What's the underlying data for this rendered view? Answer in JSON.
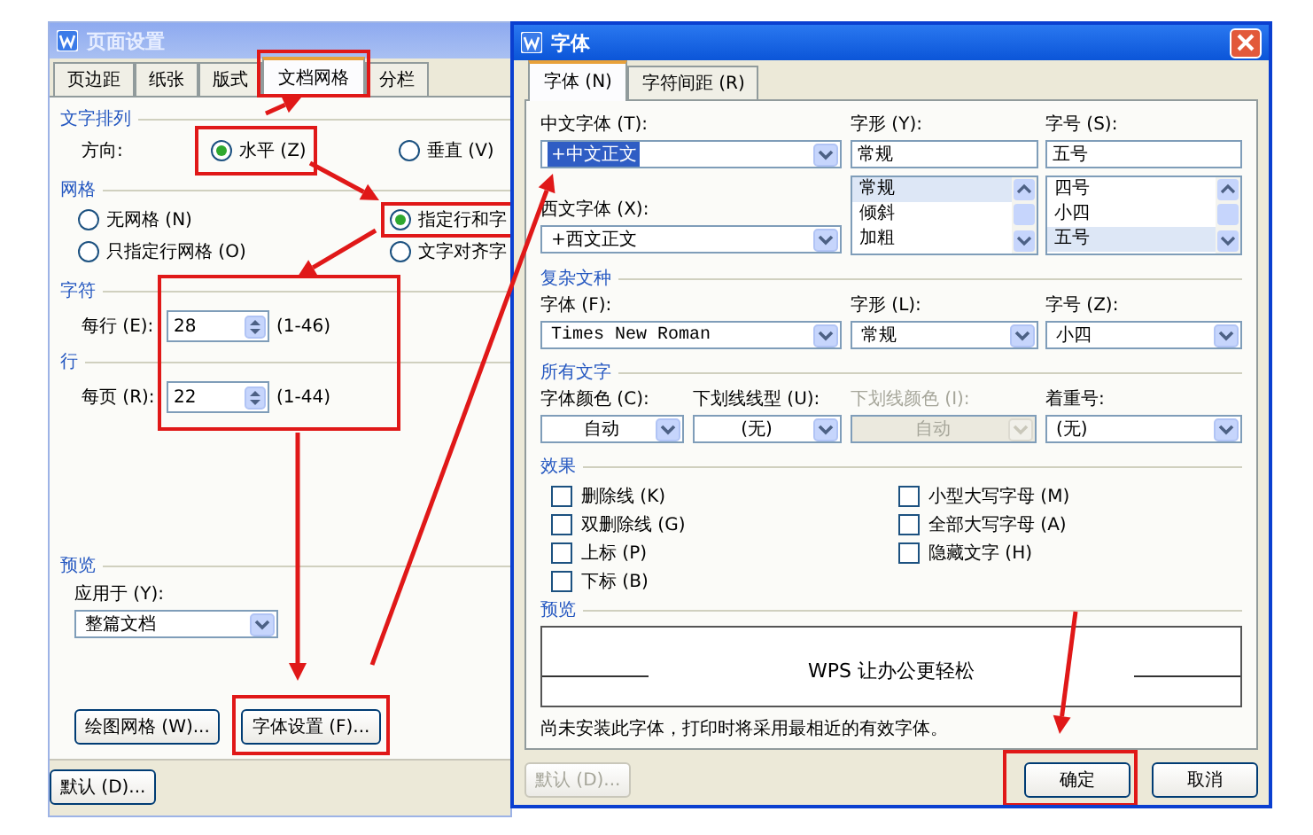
{
  "page_setup_dialog": {
    "title": "页面设置",
    "tabs": [
      {
        "label": "页边距",
        "selected": false
      },
      {
        "label": "纸张",
        "selected": false
      },
      {
        "label": "版式",
        "selected": false
      },
      {
        "label": "文档网格",
        "selected": true
      },
      {
        "label": "分栏",
        "selected": false
      }
    ],
    "text_direction": {
      "heading": "文字排列",
      "label": "方向:",
      "options": [
        {
          "label": "水平 (Z)",
          "selected": true
        },
        {
          "label": "垂直 (V)",
          "selected": false
        }
      ]
    },
    "grid": {
      "heading": "网格",
      "options": [
        {
          "label": "无网格 (N)",
          "selected": false
        },
        {
          "label": "指定行和字",
          "selected": true
        },
        {
          "label": "只指定行网格 (O)",
          "selected": false
        },
        {
          "label": "文字对齐字",
          "selected": false
        }
      ]
    },
    "characters": {
      "heading": "字符",
      "label": "每行 (E):",
      "value": "28",
      "range": "(1-46)"
    },
    "lines": {
      "heading": "行",
      "label": "每页 (R):",
      "value": "22",
      "range": "(1-44)"
    },
    "preview": {
      "heading": "预览",
      "apply_label": "应用于 (Y):",
      "apply_value": "整篇文档"
    },
    "buttons": [
      "绘图网格 (W)...",
      "字体设置 (F)..."
    ],
    "footer_buttons": [
      "默认 (D)..."
    ]
  },
  "font_dialog": {
    "title": "字体",
    "tabs": [
      {
        "label": "字体 (N)",
        "selected": true
      },
      {
        "label": "字符间距 (R)",
        "selected": false
      }
    ],
    "chinese_font": {
      "label": "中文字体 (T):",
      "value": "+中文正文",
      "text_selected": true
    },
    "style": {
      "label": "字形 (Y):",
      "value": "常规",
      "options": [
        {
          "label": "常规",
          "selected": true
        },
        {
          "label": "倾斜",
          "selected": false
        },
        {
          "label": "加粗",
          "selected": false
        }
      ]
    },
    "size": {
      "label": "字号 (S):",
      "value": "五号",
      "options": [
        {
          "label": "四号",
          "selected": false
        },
        {
          "label": "小四",
          "selected": false
        },
        {
          "label": "五号",
          "selected": true
        }
      ]
    },
    "western_font": {
      "label": "西文字体 (X):",
      "value": "+西文正文",
      "text_selected": false
    },
    "complex_script": {
      "heading": "复杂文种",
      "fields": [
        {
          "label": "字体 (F):",
          "value": "Times New Roman",
          "disabled": false
        },
        {
          "label": "字形 (L):",
          "value": "常规",
          "disabled": false
        },
        {
          "label": "字号 (Z):",
          "value": "小四",
          "disabled": false
        }
      ]
    },
    "all_text": {
      "heading": "所有文字",
      "fields": [
        {
          "label": "字体颜色 (C):",
          "value": "自动",
          "disabled": false
        },
        {
          "label": "下划线线型 (U):",
          "value": "(无)",
          "disabled": false
        },
        {
          "label": "下划线颜色 (I):",
          "value": "自动",
          "disabled": true
        },
        {
          "label": "着重号:",
          "value": "(无)",
          "disabled": false
        }
      ]
    },
    "effects": {
      "heading": "效果",
      "items": [
        {
          "label": "删除线 (K)",
          "checked": false
        },
        {
          "label": "双删除线 (G)",
          "checked": false
        },
        {
          "label": "上标 (P)",
          "checked": false
        },
        {
          "label": "下标 (B)",
          "checked": false
        },
        {
          "label": "小型大写字母 (M)",
          "checked": false
        },
        {
          "label": "全部大写字母 (A)",
          "checked": false
        },
        {
          "label": "隐藏文字 (H)",
          "checked": false
        }
      ]
    },
    "preview": {
      "heading": "预览",
      "sample": "WPS 让办公更轻松"
    },
    "note": "尚未安装此字体，打印时将采用最相近的有效字体。",
    "buttons": [
      {
        "label": "默认 (D)...",
        "disabled": true
      },
      {
        "label": "确定",
        "disabled": false
      },
      {
        "label": "取消",
        "disabled": false
      }
    ]
  }
}
